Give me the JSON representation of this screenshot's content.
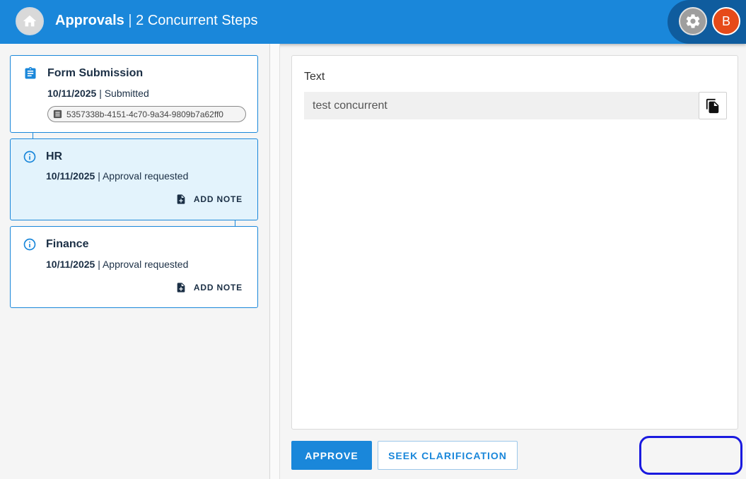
{
  "header": {
    "title_bold": "Approvals",
    "title_separator": "|",
    "title_rest": "2 Concurrent Steps",
    "avatar_initial": "B",
    "home_icon": "home-icon",
    "settings_icon": "gear-icon",
    "brand_color": "#1a87da",
    "avatar_color": "#e64a19"
  },
  "steps": [
    {
      "title": "Form Submission",
      "date": "10/11/2025",
      "separator": "|",
      "status": "Submitted",
      "icon": "clipboard-icon",
      "chip_icon": "document-list-icon",
      "chip_text": "5357338b-4151-4c70-9a34-9809b7a62ff0"
    },
    {
      "title": "HR",
      "date": "10/11/2025",
      "separator": "|",
      "status": "Approval requested",
      "icon": "info-icon",
      "add_note_label": "ADD NOTE",
      "add_note_icon": "add-note-icon",
      "active": true
    },
    {
      "title": "Finance",
      "date": "10/11/2025",
      "separator": "|",
      "status": "Approval requested",
      "icon": "info-icon",
      "add_note_label": "ADD NOTE",
      "add_note_icon": "add-note-icon"
    }
  ],
  "form": {
    "field_label": "Text",
    "field_value": "test concurrent",
    "copy_icon": "copy-icon"
  },
  "actions": {
    "approve_label": "APPROVE",
    "seek_label": "SEEK CLARIFICATION"
  }
}
